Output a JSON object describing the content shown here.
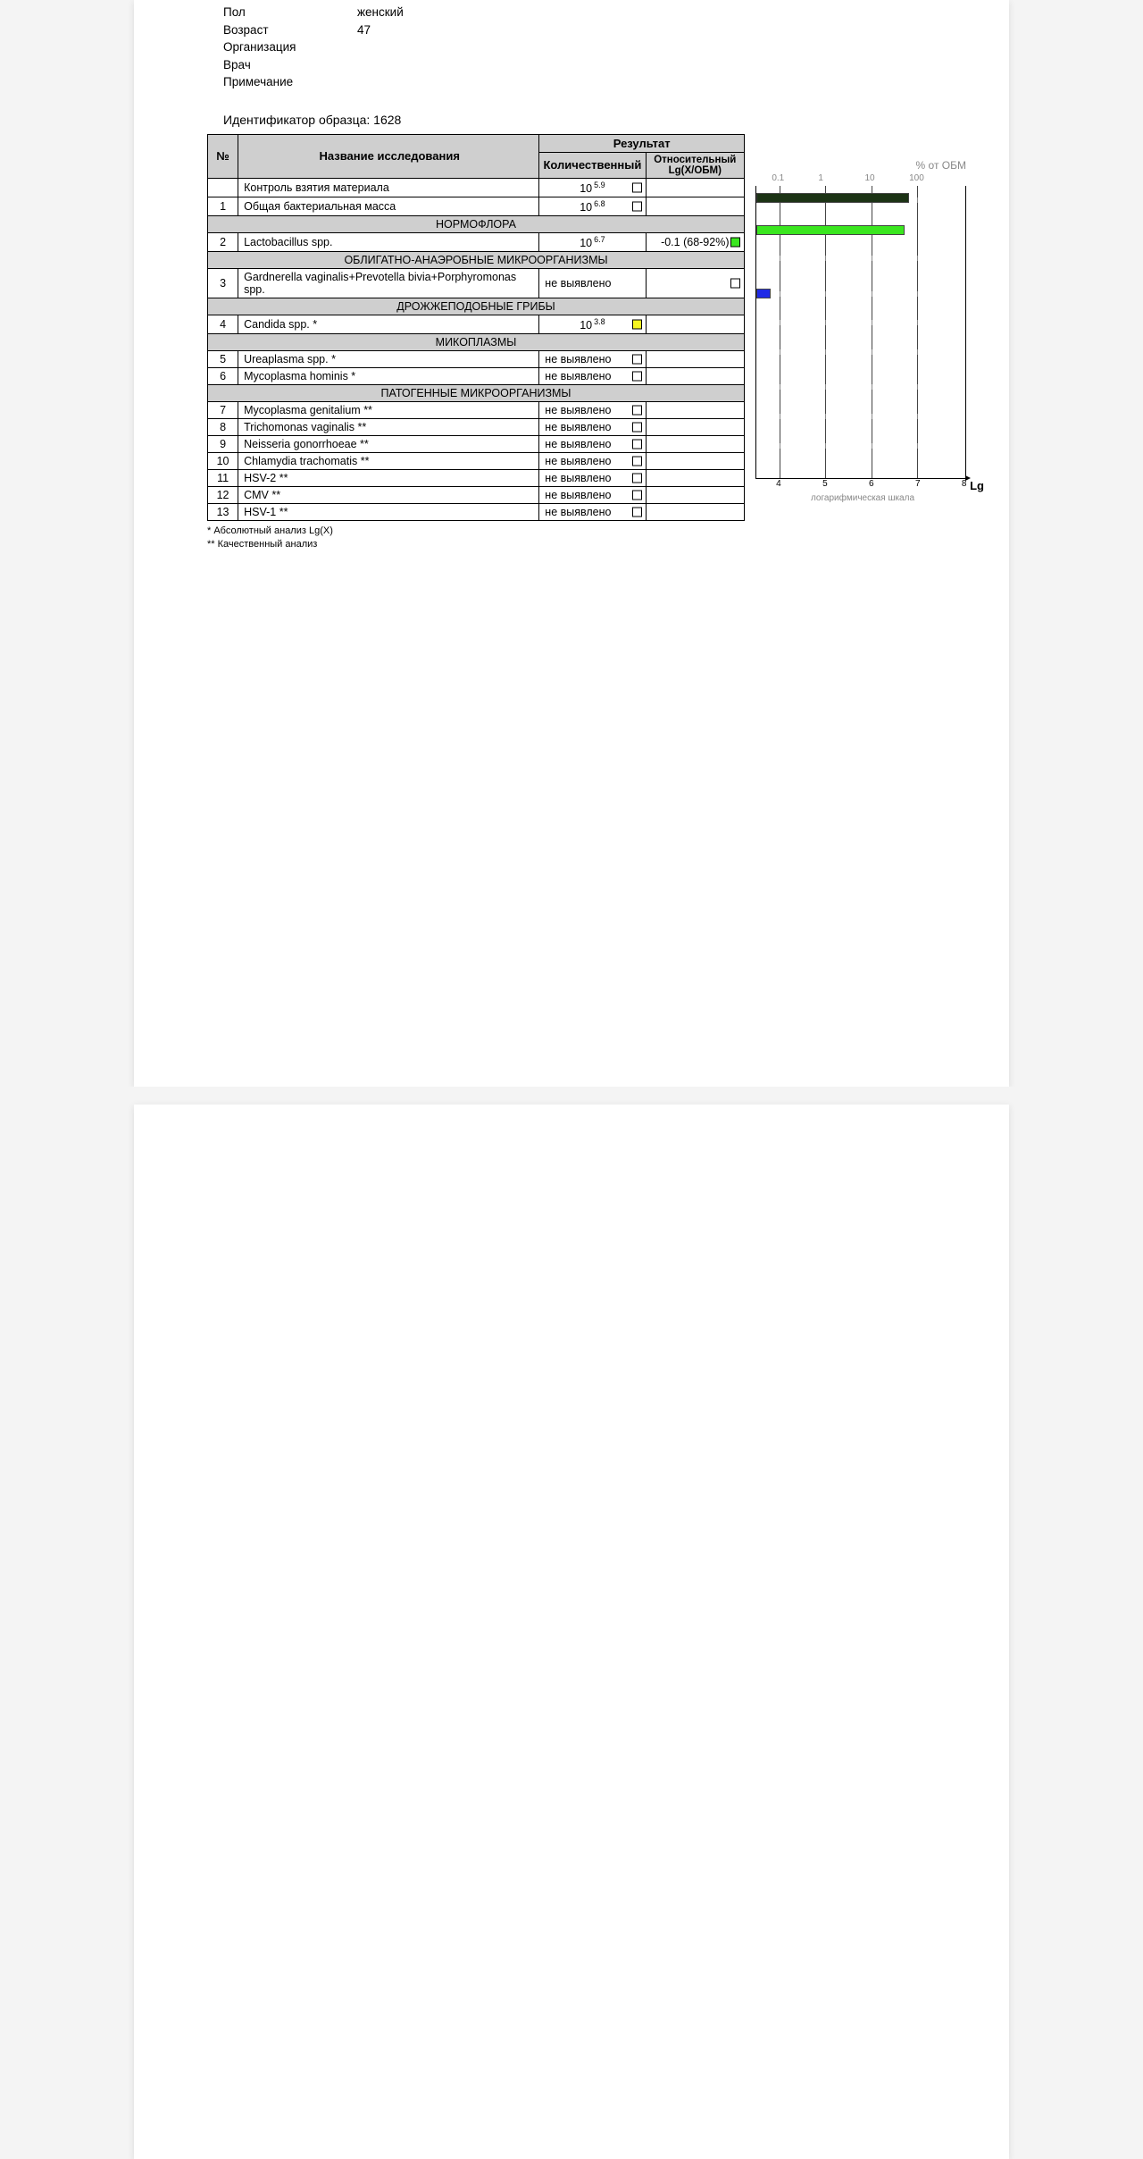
{
  "patient": {
    "labels": {
      "sex": "Пол",
      "age": "Возраст",
      "org": "Организация",
      "doctor": "Врач",
      "note": "Примечание"
    },
    "sex": "женский",
    "age": "47",
    "org": "",
    "doctor": "",
    "note": ""
  },
  "sample_id_label": "Идентификатор образца: 1628",
  "headers": {
    "num": "№",
    "name": "Название исследования",
    "result": "Результат",
    "quant": "Количественный",
    "rel": "Относительный Lg(X/ОБМ)"
  },
  "sections": {
    "normoflora": "НОРМОФЛОРА",
    "obligate": "ОБЛИГАТНО-АНАЭРОБНЫЕ МИКРООРГАНИЗМЫ",
    "yeast": "ДРОЖЖЕПОДОБНЫЕ ГРИБЫ",
    "myco": "МИКОПЛАЗМЫ",
    "pathogen": "ПАТОГЕННЫЕ МИКРООРГАНИЗМЫ"
  },
  "not_detected": "не выявлено",
  "rows": {
    "r0": {
      "num": "",
      "name": "Контроль взятия материала",
      "base": "10",
      "exp": "5.9"
    },
    "r1": {
      "num": "1",
      "name": "Общая бактериальная масса",
      "base": "10",
      "exp": "6.8"
    },
    "r2": {
      "num": "2",
      "name": "Lactobacillus spp.",
      "base": "10",
      "exp": "6.7",
      "rel": "-0.1 (68-92%)"
    },
    "r3": {
      "num": "3",
      "name": "Gardnerella vaginalis+Prevotella bivia+Porphyromonas spp."
    },
    "r4": {
      "num": "4",
      "name": "Candida spp. *",
      "base": "10",
      "exp": "3.8"
    },
    "r5": {
      "num": "5",
      "name": "Ureaplasma spp. *"
    },
    "r6": {
      "num": "6",
      "name": "Mycoplasma hominis *"
    },
    "r7": {
      "num": "7",
      "name": "Mycoplasma genitalium **"
    },
    "r8": {
      "num": "8",
      "name": "Trichomonas vaginalis **"
    },
    "r9": {
      "num": "9",
      "name": "Neisseria gonorrhoeae **"
    },
    "r10": {
      "num": "10",
      "name": "Chlamydia trachomatis **"
    },
    "r11": {
      "num": "11",
      "name": "HSV-2 **"
    },
    "r12": {
      "num": "12",
      "name": "CMV **"
    },
    "r13": {
      "num": "13",
      "name": "HSV-1 **"
    }
  },
  "footnotes": {
    "f1": "*  Абсолютный анализ Lg(X)",
    "f2": "** Качественный анализ"
  },
  "chart": {
    "title": "% от ОБМ",
    "top_ticks": [
      "0.1",
      "1",
      "10",
      "100"
    ],
    "bottom_ticks": [
      "4",
      "5",
      "6",
      "7",
      "8"
    ],
    "x_caption": "логарифмическая шкала",
    "lg": "Lg"
  },
  "chart_data": {
    "type": "bar",
    "xlabel": "логарифмическая шкала",
    "title": "% от ОБМ",
    "x_range_lg": [
      3.5,
      8.0
    ],
    "top_scale_percent_obm": [
      0.1,
      1,
      10,
      100
    ],
    "series": [
      {
        "name": "Общая бактериальная масса",
        "lg_value": 6.8,
        "color": "#1c3315"
      },
      {
        "name": "Lactobacillus spp.",
        "lg_value": 6.7,
        "color": "#3ae61f"
      },
      {
        "name": "Candida spp.",
        "lg_value": 3.8,
        "color": "#1f2ae6"
      }
    ]
  }
}
